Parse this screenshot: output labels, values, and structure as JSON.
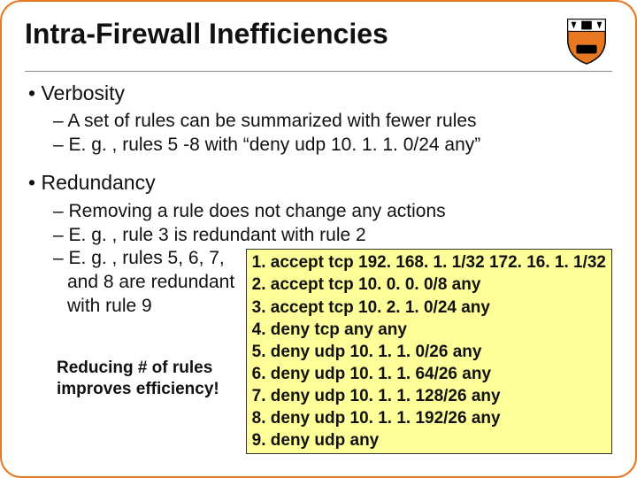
{
  "title": "Intra-Firewall Inefficiencies",
  "crest_label": "Princeton shield",
  "sections": {
    "verbosity": {
      "heading": "Verbosity",
      "lines": [
        "A set of rules can be summarized with fewer rules",
        "E. g. , rules 5 -8 with “deny udp 10. 1. 1. 0/24 any”"
      ]
    },
    "redundancy": {
      "heading": "Redundancy",
      "lines": [
        "Removing a rule does not change any actions",
        "E. g. , rule 3 is redundant with rule 2"
      ],
      "split_line_a": "E. g. , rules 5, 6, 7,",
      "split_line_b": "and 8 are redundant",
      "split_line_c": "with rule 9"
    }
  },
  "caption_a": "Reducing # of rules",
  "caption_b": "improves efficiency!",
  "rules": [
    "1. accept tcp 192. 168. 1. 1/32 172. 16. 1. 1/32",
    "2. accept tcp 10. 0. 0. 0/8 any",
    "3. accept tcp 10. 2. 1. 0/24 any",
    "4. deny tcp any any",
    "5. deny udp 10. 1. 1. 0/26 any",
    "6. deny udp 10. 1. 1. 64/26 any",
    "7. deny udp 10. 1. 1. 128/26 any",
    "8. deny udp 10. 1. 1. 192/26 any",
    "9. deny udp any"
  ]
}
